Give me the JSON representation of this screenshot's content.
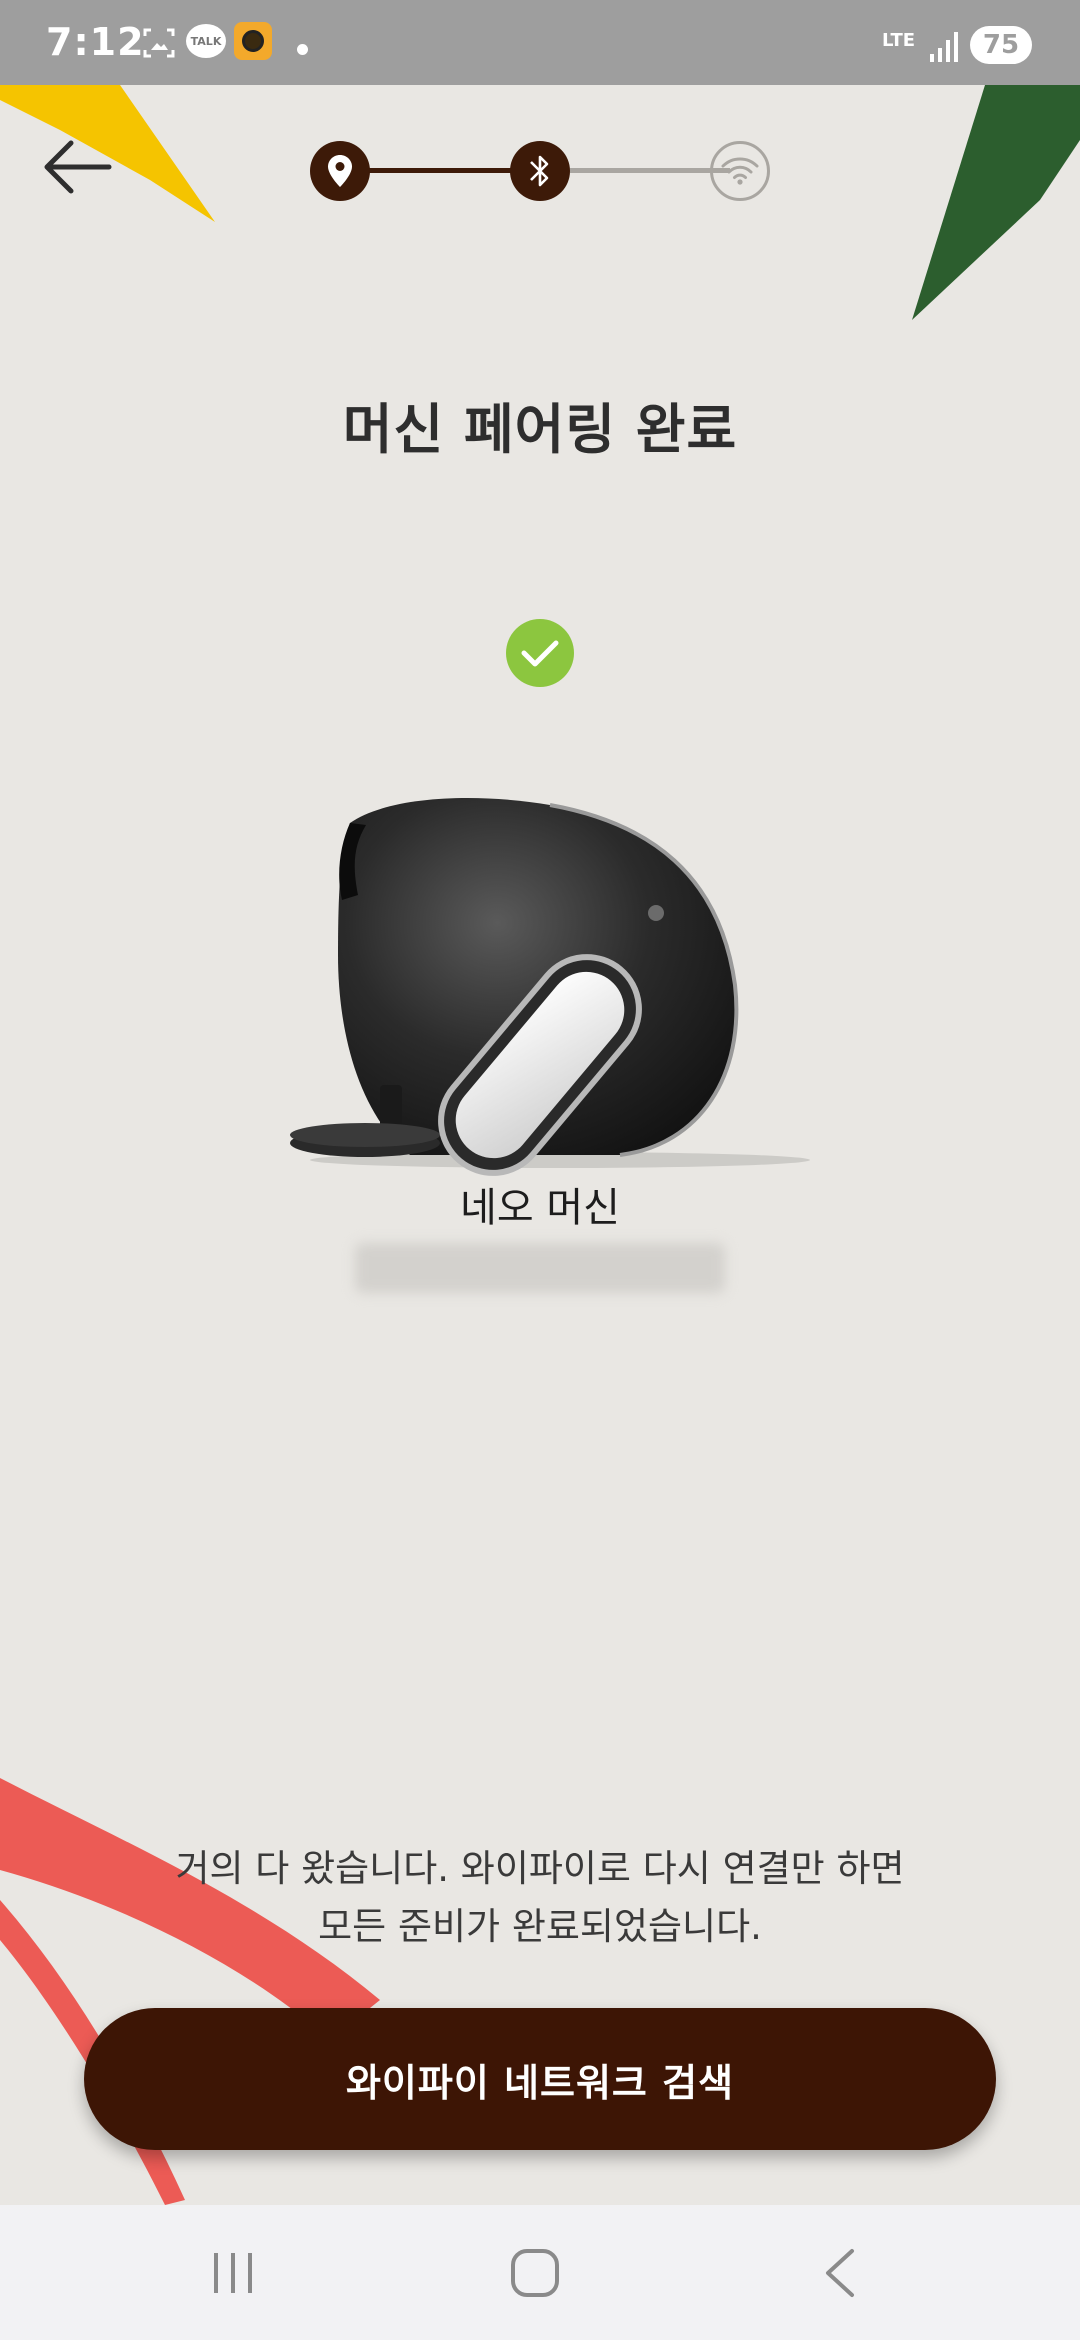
{
  "status_bar": {
    "time": "7:12",
    "talk_badge": "TALK",
    "network": "LTE",
    "battery": "75",
    "icons": [
      "screenshot-icon",
      "kakaotalk-icon",
      "camera-app-icon",
      "notification-dot-icon",
      "lte-icon",
      "signal-icon",
      "battery-icon"
    ]
  },
  "header": {
    "back_icon": "arrow-left-icon",
    "steps": [
      {
        "icon": "location-pin-icon",
        "state": "done"
      },
      {
        "icon": "bluetooth-icon",
        "state": "done"
      },
      {
        "icon": "wifi-icon",
        "state": "pending"
      }
    ]
  },
  "main": {
    "title": "머신 페어링 완료",
    "success_icon": "check-circle-icon",
    "machine_name": "네오 머신",
    "info_line1": "거의 다 왔습니다. 와이파이로 다시 연결만 하면",
    "info_line2": "모든 준비가 완료되었습니다."
  },
  "actions": {
    "wifi_search_label": "와이파이 네트워크 검색"
  },
  "colors": {
    "background": "#e9e7e3",
    "primary_brown": "#3d1505",
    "success_green": "#8cc63f",
    "deco_yellow": "#f5c400",
    "deco_green": "#2c5e2e",
    "deco_red": "#ec5b55"
  },
  "system_nav": {
    "icons": [
      "recent-apps-icon",
      "home-icon",
      "back-icon"
    ]
  }
}
